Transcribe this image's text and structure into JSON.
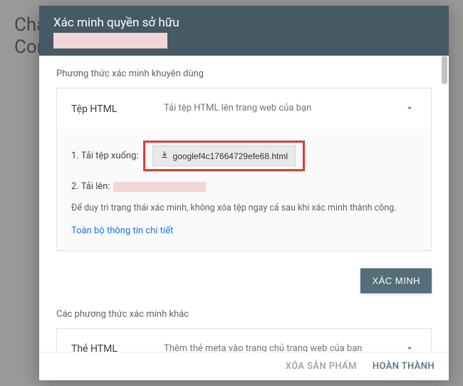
{
  "backdrop": {
    "line1": "Chà",
    "line2": "Con"
  },
  "header": {
    "title": "Xác minh quyền sở hữu"
  },
  "section_recommended": "Phương thức xác minh khuyên dùng",
  "html_file": {
    "name": "Tệp HTML",
    "desc": "Tải tệp HTML lên trang web của bạn",
    "step1_label": "1. Tải tệp xuống:",
    "download_filename": "googlef4c17664729efe68.html",
    "step2_label": "2. Tải lên:",
    "note": "Để duy trì trạng thái xác minh, không xóa tệp ngay cả sau khi xác minh thành công.",
    "details_link": "Toàn bộ thông tin chi tiết"
  },
  "verify_button": "XÁC MINH",
  "section_other": "Các phương thức xác minh khác",
  "html_tag": {
    "name": "Thẻ HTML",
    "desc": "Thêm thẻ meta vào trang chủ trang web của bạn"
  },
  "footer": {
    "delete": "XÓA SẢN PHẨM",
    "done": "HOÀN THÀNH"
  }
}
